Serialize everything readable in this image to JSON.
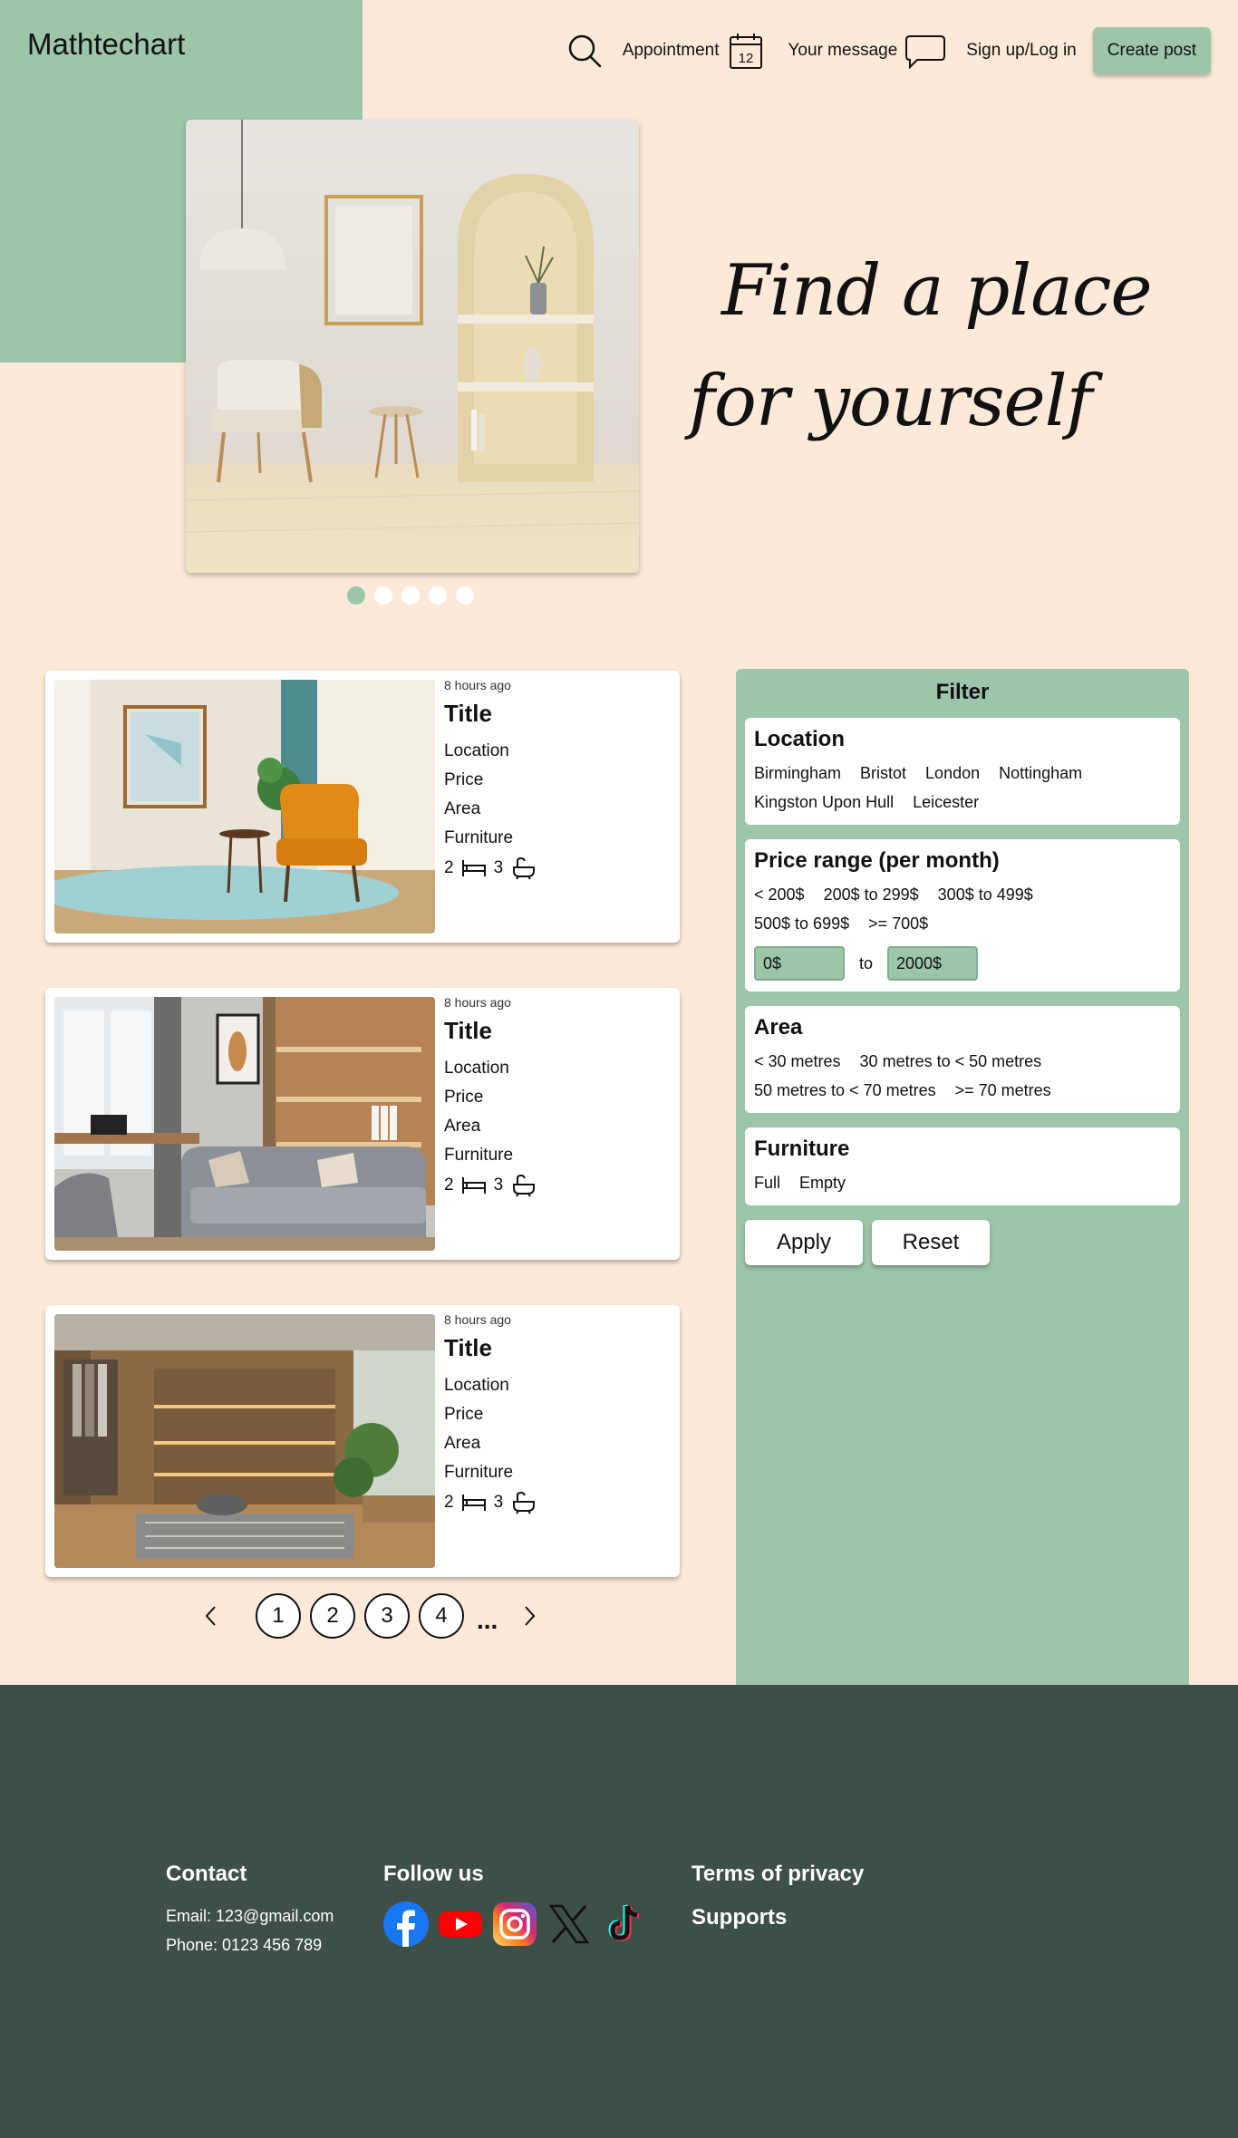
{
  "brand": {
    "logo": "Mathtechart",
    "accent": "#9cc5a9",
    "background": "#fce9d7",
    "footer_bg": "#3d4f46"
  },
  "nav": {
    "search_icon": "search-icon",
    "appointment": "Appointment",
    "calendar_day": "12",
    "message": "Your message",
    "signup": "Sign up/Log in",
    "create_post": "Create post"
  },
  "hero": {
    "tagline_line1": "Find a place",
    "tagline_line2": "for yourself",
    "slides": 5,
    "active_slide": 1
  },
  "listings": [
    {
      "time": "8 hours ago",
      "title": "Title",
      "location": "Location",
      "price": "Price",
      "area": "Area",
      "furniture": "Furniture",
      "beds": "2",
      "baths": "3"
    },
    {
      "time": "8 hours ago",
      "title": "Title",
      "location": "Location",
      "price": "Price",
      "area": "Area",
      "furniture": "Furniture",
      "beds": "2",
      "baths": "3"
    },
    {
      "time": "8 hours ago",
      "title": "Title",
      "location": "Location",
      "price": "Price",
      "area": "Area",
      "furniture": "Furniture",
      "beds": "2",
      "baths": "3"
    }
  ],
  "pagination": {
    "pages": [
      "1",
      "2",
      "3",
      "4"
    ],
    "ellipsis": "..."
  },
  "filter": {
    "title": "Filter",
    "location": {
      "heading": "Location",
      "options": [
        "Birmingham",
        "Bristot",
        "London",
        "Nottingham",
        "Kingston Upon Hull",
        "Leicester"
      ]
    },
    "price": {
      "heading": "Price range (per month)",
      "options": [
        "< 200$",
        "200$ to 299$",
        "300$ to 499$",
        "500$ to 699$",
        ">= 700$"
      ],
      "from": "0$",
      "to_label": "to",
      "to": "2000$"
    },
    "area": {
      "heading": "Area",
      "options": [
        "< 30 metres",
        "30 metres to < 50 metres",
        "50 metres to < 70 metres",
        ">= 70 metres"
      ]
    },
    "furniture": {
      "heading": "Furniture",
      "options": [
        "Full",
        "Empty"
      ]
    },
    "apply": "Apply",
    "reset": "Reset"
  },
  "footer": {
    "contact_heading": "Contact",
    "email": "Email: 123@gmail.com",
    "phone": "Phone: 0123 456 789",
    "follow_heading": "Follow us",
    "socials": [
      "facebook-icon",
      "youtube-icon",
      "instagram-icon",
      "x-icon",
      "tiktok-icon"
    ],
    "terms": "Terms of privacy",
    "supports": "Supports"
  }
}
